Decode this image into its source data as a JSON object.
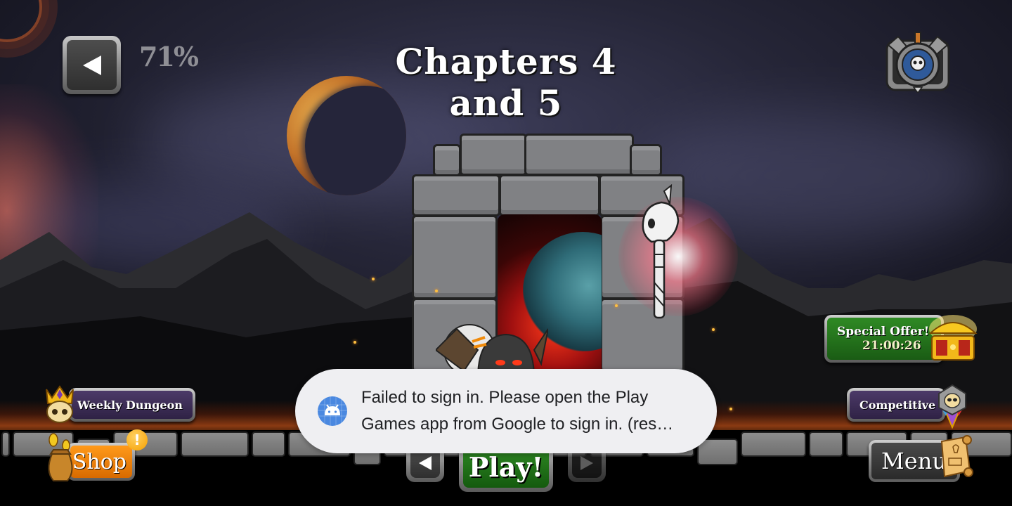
{
  "header": {
    "back_icon": "triangle-left-icon",
    "completion_percent": "71%",
    "title": "Chapters 4 and 5",
    "achievements_icon": "shield-skull-crossed-axes-icon"
  },
  "side_buttons": {
    "special_offer": {
      "label": "Special Offer!",
      "timer": "21:00:26",
      "icon": "treasure-chest-icon"
    },
    "weekly_dungeon": {
      "label": "Weekly Dungeon",
      "icon": "crowned-skull-icon"
    },
    "competitive": {
      "label": "Competitive",
      "icon": "skull-badge-icon"
    }
  },
  "bottom_bar": {
    "shop": {
      "label": "Shop",
      "icon": "coin-bag-icon",
      "alert_badge": "!"
    },
    "play": {
      "label": "Play!"
    },
    "prev_chapter_icon": "triangle-left-icon",
    "next_chapter_icon": "triangle-right-icon",
    "menu": {
      "label": "Menu",
      "icon": "scroll-icon"
    }
  },
  "toast": {
    "icon": "android-icon",
    "line1": "Failed to sign in. Please open the Play",
    "line2": "Games app from Google to sign in. (res…"
  },
  "colors": {
    "offer_green": "#1f6e18",
    "dungeon_purple": "#3a2b52",
    "shop_orange": "#f08a0a",
    "toast_bg": "#efeff2",
    "android_blue": "#4a88e0"
  }
}
